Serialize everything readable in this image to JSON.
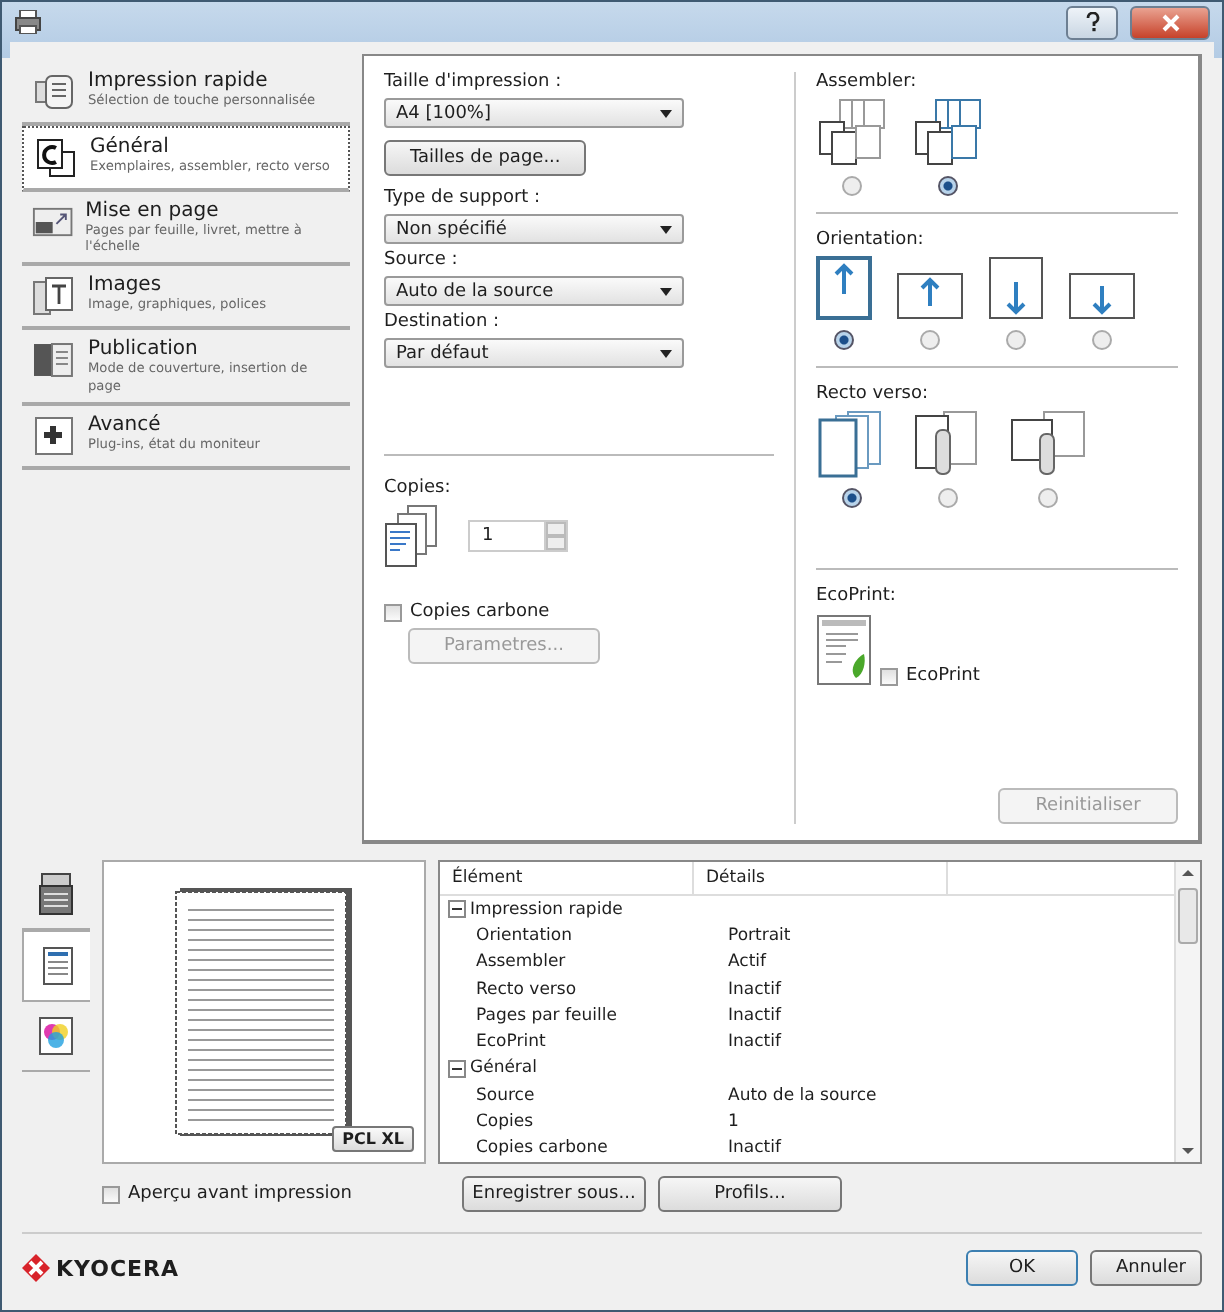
{
  "sidebar": {
    "items": [
      {
        "title": "Impression rapide",
        "subtitle": "Sélection de touche personnalisée",
        "selected": false,
        "kind": "quick"
      },
      {
        "title": "Général",
        "subtitle": "Exemplaires, assembler, recto verso",
        "selected": true,
        "kind": "general"
      },
      {
        "title": "Mise en page",
        "subtitle": "Pages par feuille, livret, mettre à l'échelle",
        "selected": false,
        "kind": "layout"
      },
      {
        "title": "Images",
        "subtitle": "Image, graphiques, polices",
        "selected": false,
        "kind": "images"
      },
      {
        "title": "Publication",
        "subtitle": "Mode de couverture, insertion de page",
        "selected": false,
        "kind": "publication"
      },
      {
        "title": "Avancé",
        "subtitle": "Plug-ins, état du moniteur",
        "selected": false,
        "kind": "advanced"
      }
    ]
  },
  "settings": {
    "size_label": "Taille d'impression :",
    "size_value": "A4 [100%]",
    "page_sizes_button": "Tailles de page...",
    "fields": [
      {
        "label": "Type de support :",
        "value": "Non spécifié"
      },
      {
        "label": "Source :",
        "value": "Auto de la source"
      },
      {
        "label": "Destination :",
        "value": "Par défaut"
      }
    ],
    "copies_label": "Copies:",
    "copies_value": "1",
    "carbon": {
      "label": "Copies carbone",
      "checked": false
    },
    "parameters_button": {
      "label": "Parametres...",
      "disabled": true
    },
    "assembler": {
      "label": "Assembler:",
      "options": [
        {
          "selected": false
        },
        {
          "selected": true
        }
      ]
    },
    "orientation": {
      "label": "Orientation:",
      "options": [
        {
          "kind": "portrait",
          "selected": true
        },
        {
          "kind": "landscape",
          "selected": false
        },
        {
          "kind": "portrait-rotated",
          "selected": false
        },
        {
          "kind": "landscape-rotated",
          "selected": false
        }
      ]
    },
    "duplex": {
      "label": "Recto verso:",
      "options": [
        {
          "kind": "off",
          "selected": true
        },
        {
          "kind": "long",
          "selected": false
        },
        {
          "kind": "short",
          "selected": false
        }
      ]
    },
    "ecoprint": {
      "label": "EcoPrint:",
      "checkbox": "EcoPrint",
      "checked": false
    },
    "reset_button": {
      "label": "Reinitialiser",
      "disabled": true
    }
  },
  "preview": {
    "tabs": [
      {
        "kind": "printer",
        "selected": false
      },
      {
        "kind": "page",
        "selected": true
      },
      {
        "kind": "color",
        "selected": false
      }
    ],
    "badge": "PCL XL",
    "checkbox": {
      "label": "Aperçu avant impression",
      "checked": false
    }
  },
  "summary": {
    "columns": [
      "Élément",
      "Détails"
    ],
    "groups": [
      {
        "label": "Impression rapide",
        "expanded": true,
        "children": [
          {
            "name": "Orientation",
            "detail": "Portrait"
          },
          {
            "name": "Assembler",
            "detail": "Actif"
          },
          {
            "name": "Recto verso",
            "detail": "Inactif"
          },
          {
            "name": "Pages par feuille",
            "detail": "Inactif"
          },
          {
            "name": "EcoPrint",
            "detail": "Inactif"
          }
        ]
      },
      {
        "label": "Général",
        "expanded": true,
        "children": [
          {
            "name": "Source",
            "detail": "Auto de la source"
          },
          {
            "name": "Copies",
            "detail": "1"
          },
          {
            "name": "Copies carbone",
            "detail": "Inactif"
          }
        ]
      }
    ]
  },
  "buttons": {
    "save": "Enregistrer sous...",
    "profiles": "Profils...",
    "ok": "OK",
    "cancel": "Annuler"
  },
  "brand": "KYOCERA"
}
